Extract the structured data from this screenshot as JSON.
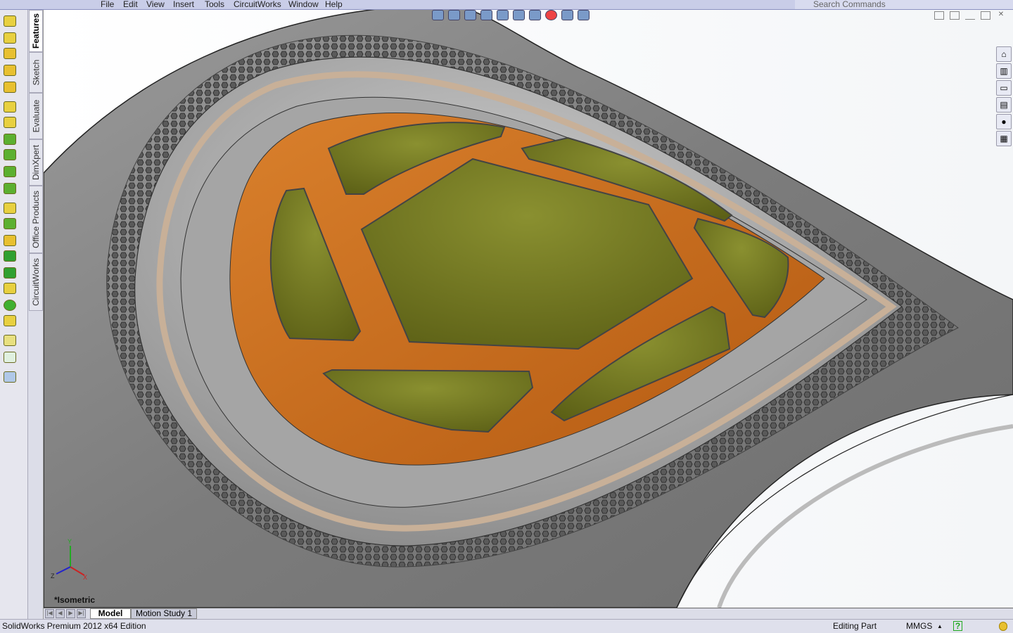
{
  "menu": {
    "items": [
      "File",
      "Edit",
      "View",
      "Insert",
      "Tools",
      "CircuitWorks",
      "Window",
      "Help"
    ]
  },
  "search": {
    "placeholder": "Search Commands"
  },
  "command_tabs": [
    {
      "label": "Features",
      "active": true
    },
    {
      "label": "Sketch"
    },
    {
      "label": "Evaluate"
    },
    {
      "label": "DimXpert"
    },
    {
      "label": "Office Products"
    },
    {
      "label": "CircuitWorks"
    }
  ],
  "viewport": {
    "view_name": "*Isometric",
    "triad": {
      "x": "X",
      "y": "Y",
      "z": "Z"
    }
  },
  "bottom_tabs": [
    {
      "label": "Model",
      "active": true
    },
    {
      "label": "Motion Study 1"
    }
  ],
  "status": {
    "product": "SolidWorks Premium 2012 x64 Edition",
    "mode": "Editing Part",
    "units": "MMGS",
    "units_arrow": "▲",
    "help": "?"
  },
  "colors": {
    "body": "#8c8c8c",
    "orange": "#c8661a",
    "green": "#6f751e",
    "ring": "#c8b098"
  }
}
